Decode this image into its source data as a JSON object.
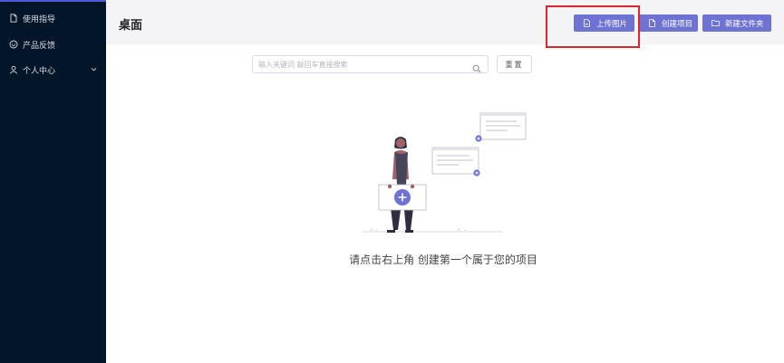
{
  "sidebar": {
    "items": [
      {
        "label": "使用指导",
        "icon": "document-icon"
      },
      {
        "label": "产品反馈",
        "icon": "feedback-icon"
      },
      {
        "label": "个人中心",
        "icon": "user-icon",
        "has_submenu": true
      }
    ]
  },
  "header": {
    "title": "桌面",
    "buttons": {
      "upload": "上传图片",
      "create_project": "创建项目",
      "new_folder": "新建文件夹"
    }
  },
  "search": {
    "placeholder": "输入关键词 敲回车直接搜索",
    "reset_label": "重置"
  },
  "empty_state": {
    "message": "请点击右上角 创建第一个属于您的项目"
  },
  "colors": {
    "sidebar_bg": "#031529",
    "accent": "#6e72d2",
    "highlight": "#e0262c",
    "header_bg": "#f4f4f7"
  }
}
